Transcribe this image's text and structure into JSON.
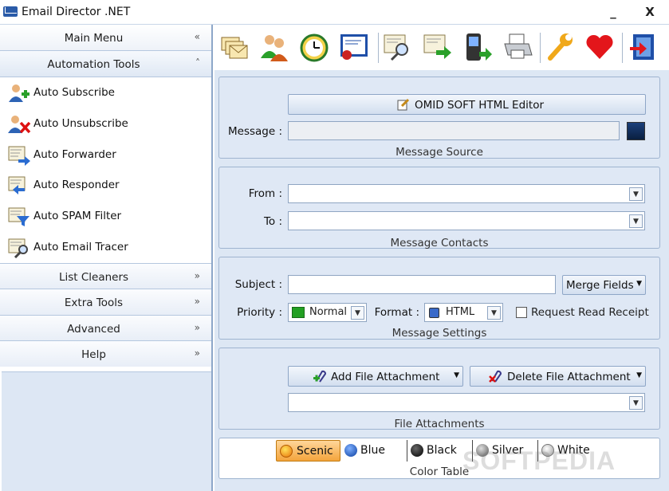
{
  "app": {
    "title": "Email Director .NET",
    "minimize": "_",
    "close": "X"
  },
  "left_panel": {
    "main_menu": "Main Menu",
    "main_menu_arrow": "«",
    "automation_tools": "Automation Tools",
    "automation_arrow": "˄",
    "tools": [
      {
        "label": "Auto Subscribe",
        "icon": "user-add-icon"
      },
      {
        "label": "Auto Unsubscribe",
        "icon": "user-remove-icon"
      },
      {
        "label": "Auto Forwarder",
        "icon": "email-forward-icon"
      },
      {
        "label": "Auto Responder",
        "icon": "email-reply-icon"
      },
      {
        "label": "Auto SPAM Filter",
        "icon": "spam-filter-icon"
      },
      {
        "label": "Auto Email Tracer",
        "icon": "email-search-icon"
      }
    ],
    "sections": [
      {
        "label": "List Cleaners",
        "arrow": "»"
      },
      {
        "label": "Extra Tools",
        "arrow": "»"
      },
      {
        "label": "Advanced",
        "arrow": "»"
      },
      {
        "label": "Help",
        "arrow": "»"
      }
    ]
  },
  "toolbar": {
    "icons": [
      "emails-icon",
      "users-icon",
      "schedule-icon",
      "certificate-icon",
      "search-email-icon",
      "send-email-icon",
      "mobile-icon",
      "print-icon",
      "settings-wrench-icon",
      "heart-icon",
      "exit-icon"
    ]
  },
  "message_source": {
    "editor_button": "OMID SOFT HTML Editor",
    "message_label": "Message :",
    "message_value": "",
    "group_label": "Message Source"
  },
  "message_contacts": {
    "from_label": "From :",
    "from_value": "",
    "to_label": "To :",
    "to_value": "",
    "group_label": "Message Contacts"
  },
  "message_settings": {
    "subject_label": "Subject :",
    "subject_value": "",
    "merge_fields": "Merge Fields",
    "priority_label": "Priority :",
    "priority_value": "Normal",
    "format_label": "Format :",
    "format_value": "HTML",
    "read_receipt": "Request Read Receipt",
    "group_label": "Message Settings"
  },
  "file_attachments": {
    "add_button": "Add File Attachment",
    "delete_button": "Delete File Attachment",
    "group_label": "File Attachments"
  },
  "color_table": {
    "options": [
      {
        "label": "Scenic",
        "color": "#f29a1a"
      },
      {
        "label": "Blue",
        "color": "#1f5fc8"
      },
      {
        "label": "Black",
        "color": "#111111"
      },
      {
        "label": "Silver",
        "color": "#8a8a8a"
      },
      {
        "label": "White",
        "color": "#d9d9d9"
      }
    ],
    "selected": "Scenic",
    "group_label": "Color Table"
  },
  "watermark": "SOFTPEDIA"
}
